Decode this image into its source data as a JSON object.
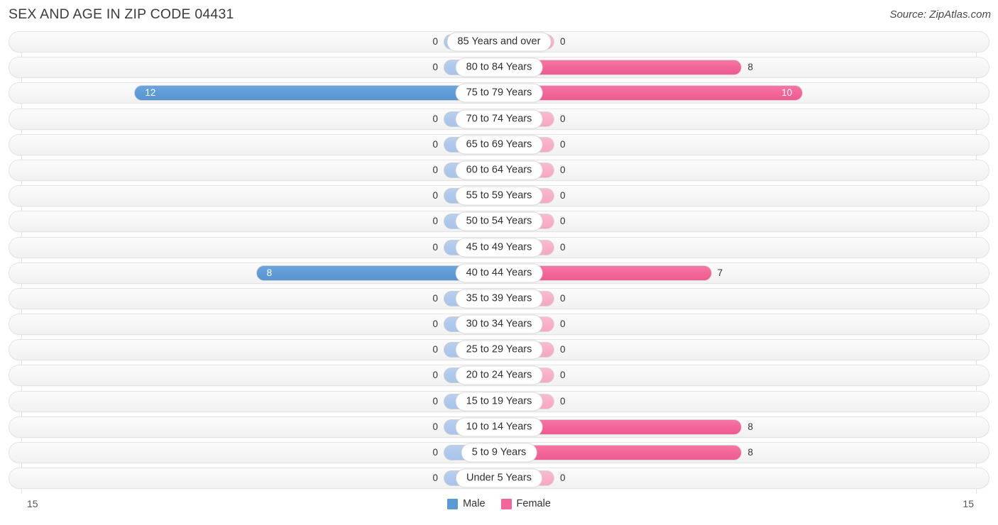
{
  "header": {
    "title": "SEX AND AGE IN ZIP CODE 04431",
    "source": "Source: ZipAtlas.com"
  },
  "axis": {
    "left_tick": "15",
    "right_tick": "15"
  },
  "legend": {
    "male_label": "Male",
    "female_label": "Female",
    "male_color": "#5b9bd5",
    "female_color": "#f2659a"
  },
  "chart_data": {
    "type": "bar",
    "title": "SEX AND AGE IN ZIP CODE 04431",
    "subtitle": "",
    "xlabel": "",
    "ylabel": "",
    "orientation": "horizontal-diverging",
    "xlim": [
      15,
      15
    ],
    "grid": false,
    "legend_position": "bottom-center",
    "categories": [
      "85 Years and over",
      "80 to 84 Years",
      "75 to 79 Years",
      "70 to 74 Years",
      "65 to 69 Years",
      "60 to 64 Years",
      "55 to 59 Years",
      "50 to 54 Years",
      "45 to 49 Years",
      "40 to 44 Years",
      "35 to 39 Years",
      "30 to 34 Years",
      "25 to 29 Years",
      "20 to 24 Years",
      "15 to 19 Years",
      "10 to 14 Years",
      "5 to 9 Years",
      "Under 5 Years"
    ],
    "series": [
      {
        "name": "Male",
        "color": "#5b9bd5",
        "values": [
          0,
          0,
          12,
          0,
          0,
          0,
          0,
          0,
          0,
          8,
          0,
          0,
          0,
          0,
          0,
          0,
          0,
          0
        ]
      },
      {
        "name": "Female",
        "color": "#f2659a",
        "values": [
          0,
          8,
          10,
          0,
          0,
          0,
          0,
          0,
          0,
          7,
          0,
          0,
          0,
          0,
          0,
          8,
          8,
          0
        ]
      }
    ]
  },
  "rows": [
    {
      "label": "85 Years and over",
      "male": "0",
      "female": "0"
    },
    {
      "label": "80 to 84 Years",
      "male": "0",
      "female": "8"
    },
    {
      "label": "75 to 79 Years",
      "male": "12",
      "female": "10"
    },
    {
      "label": "70 to 74 Years",
      "male": "0",
      "female": "0"
    },
    {
      "label": "65 to 69 Years",
      "male": "0",
      "female": "0"
    },
    {
      "label": "60 to 64 Years",
      "male": "0",
      "female": "0"
    },
    {
      "label": "55 to 59 Years",
      "male": "0",
      "female": "0"
    },
    {
      "label": "50 to 54 Years",
      "male": "0",
      "female": "0"
    },
    {
      "label": "45 to 49 Years",
      "male": "0",
      "female": "0"
    },
    {
      "label": "40 to 44 Years",
      "male": "8",
      "female": "7"
    },
    {
      "label": "35 to 39 Years",
      "male": "0",
      "female": "0"
    },
    {
      "label": "30 to 34 Years",
      "male": "0",
      "female": "0"
    },
    {
      "label": "25 to 29 Years",
      "male": "0",
      "female": "0"
    },
    {
      "label": "20 to 24 Years",
      "male": "0",
      "female": "0"
    },
    {
      "label": "15 to 19 Years",
      "male": "0",
      "female": "0"
    },
    {
      "label": "10 to 14 Years",
      "male": "0",
      "female": "8"
    },
    {
      "label": "5 to 9 Years",
      "male": "0",
      "female": "8"
    },
    {
      "label": "Under 5 Years",
      "male": "0",
      "female": "0"
    }
  ]
}
